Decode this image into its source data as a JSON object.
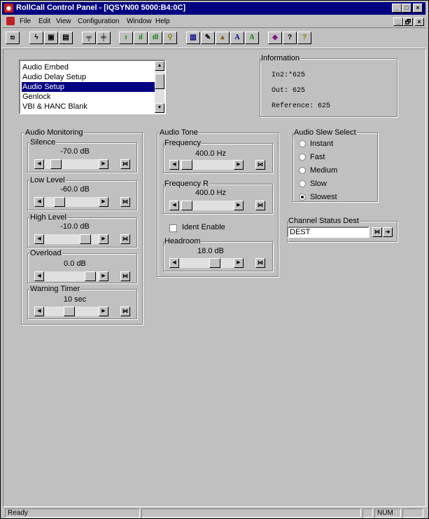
{
  "window": {
    "title": "RollCall Control Panel - [IQSYN00 5000:B4:0C]",
    "caption_buttons": [
      "_",
      "□",
      "×"
    ],
    "mdi_buttons": [
      "_",
      "🗗",
      "×"
    ]
  },
  "menu": {
    "items": [
      "File",
      "Edit",
      "View",
      "Configuration",
      "Window",
      "Help"
    ]
  },
  "toolbar": {
    "buttons": [
      "connect-icon",
      "bolt-icon",
      "save-icon",
      "save-all-icon",
      "network-icon",
      "hierarchy-icon",
      "level1-icon",
      "level2-icon",
      "level3-icon",
      "key-icon",
      "book-icon",
      "edit-icon",
      "lock-icon",
      "font-a-icon",
      "font-a-green-icon",
      "diamond-icon",
      "screen-help-icon",
      "question-icon"
    ]
  },
  "menu_list": {
    "items": [
      "Audio Embed",
      "Audio Delay Setup",
      "Audio Setup",
      "Genlock",
      "VBI & HANC Blank"
    ],
    "selected": "Audio Setup"
  },
  "information": {
    "label": "Information",
    "in2": "In2:*625",
    "out": "Out: 625",
    "reference": "Reference: 625"
  },
  "audio_monitoring": {
    "label": "Audio Monitoring",
    "silence": {
      "label": "Silence",
      "value": "-70.0 dB",
      "level": 0.15
    },
    "low_level": {
      "label": "Low Level",
      "value": "-60.0 dB",
      "level": 0.22
    },
    "high_level": {
      "label": "High Level",
      "value": "-10.0 dB",
      "level": 0.83
    },
    "overload": {
      "label": "Overload",
      "value": "0.0 dB",
      "level": 0.93
    },
    "warning_timer": {
      "label": "Warning Timer",
      "value": "10 sec",
      "level": 0.45
    }
  },
  "audio_tone": {
    "label": "Audio Tone",
    "frequency": {
      "label": "Frequency",
      "value": "400.0 Hz",
      "level": 0.05
    },
    "frequency_r": {
      "label": "Frequency R",
      "value": "400.0 Hz",
      "level": 0.05
    },
    "ident_enable": {
      "label": "Ident Enable",
      "checked": false
    },
    "headroom": {
      "label": "Headroom",
      "value": "18.0 dB",
      "level": 0.7
    }
  },
  "audio_slew": {
    "label": "Audio Slew Select",
    "options": [
      "Instant",
      "Fast",
      "Medium",
      "Slow",
      "Slowest"
    ],
    "selected": "Slowest"
  },
  "channel_status": {
    "label": "Channel Status Dest",
    "value": "DEST"
  },
  "statusbar": {
    "status": "Ready",
    "num": "NUM"
  }
}
